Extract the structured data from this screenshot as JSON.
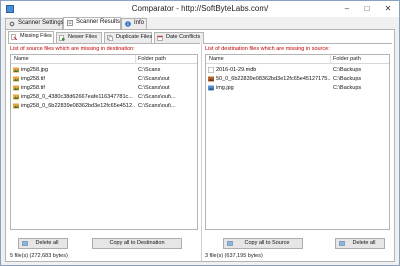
{
  "window": {
    "title": "Comparator - http://SoftByteLabs.com/"
  },
  "outer_tabs": [
    {
      "label": "Scanner Settings",
      "icon": "gear-icon"
    },
    {
      "label": "Scanner Results",
      "icon": "results-icon"
    },
    {
      "label": "Info",
      "icon": "info-icon"
    }
  ],
  "inner_tabs": [
    {
      "label": "Missing Files"
    },
    {
      "label": "Newer Files"
    },
    {
      "label": "Duplicate Files"
    },
    {
      "label": "Date Conflicts"
    }
  ],
  "left_pane": {
    "heading": "List of source files which are missing in destination:",
    "columns": {
      "name": "Name",
      "folder": "Folder path"
    },
    "rows": [
      {
        "name": "img258.jpg",
        "folder": "C:\\Scans",
        "icon": "image-file-icon"
      },
      {
        "name": "img258.tif",
        "folder": "C:\\Scans\\out",
        "icon": "image-file-icon"
      },
      {
        "name": "img258.tif",
        "folder": "C:\\Scans\\out",
        "icon": "image-file-icon"
      },
      {
        "name": "img258_0_4380c38d62667eafe116347781c...",
        "folder": "C:\\Scans\\out\\...",
        "icon": "image-file-icon"
      },
      {
        "name": "img258_0_6b22839e08362bd3e12fc65e4512...",
        "folder": "C:\\Scans\\out\\...",
        "icon": "image-file-icon"
      }
    ],
    "delete_label": "Delete all",
    "copy_label": "Copy all to Destination",
    "status": "5 file(s) (272,683 bytes)"
  },
  "right_pane": {
    "heading": "List of destination files which are missing in source:",
    "columns": {
      "name": "Name",
      "folder": "Folder path"
    },
    "rows": [
      {
        "name": "2016-01-29.mdb",
        "folder": "C:\\Backups",
        "icon": "database-file-icon"
      },
      {
        "name": "50_0_6b22839e08362bd3e12fc65e45127175...",
        "folder": "C:\\Backups",
        "icon": "image-file-icon"
      },
      {
        "name": "img.jpg",
        "folder": "C:\\Backups",
        "icon": "image-file-icon"
      }
    ],
    "copy_label": "Copy all to Source",
    "delete_label": "Delete all",
    "status": "3 file(s) (637,195 bytes)"
  },
  "colors": {
    "heading_red": "#c00000",
    "accent_blue": "#4d8fd6"
  }
}
